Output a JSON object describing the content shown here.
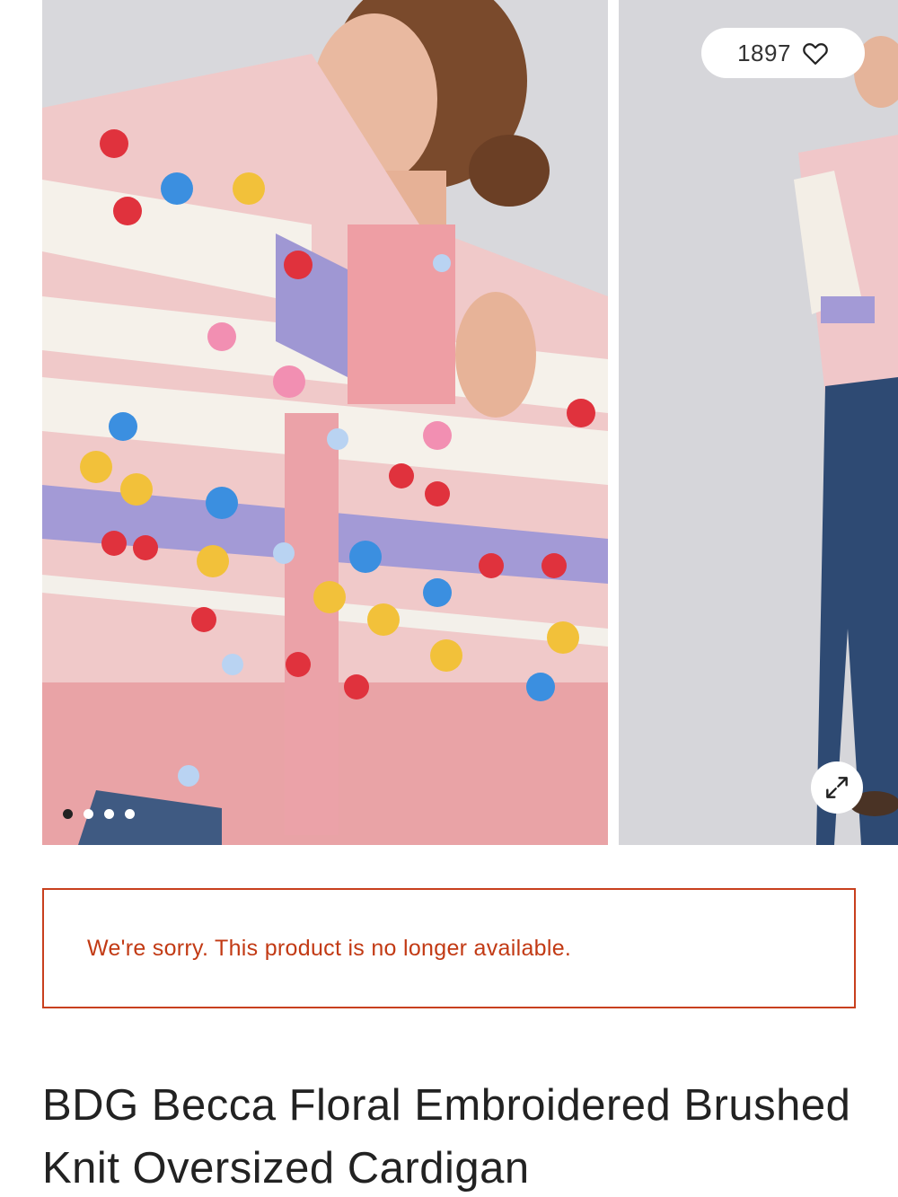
{
  "gallery": {
    "favorites_count": "1897",
    "icons": {
      "favorite": "heart-outline-icon",
      "expand": "expand-arrows-icon"
    },
    "dots": {
      "total": 4,
      "active_index": 0
    }
  },
  "notice": {
    "message": "We're sorry. This product is no longer available.",
    "color": "#c23a14"
  },
  "product": {
    "title": "BDG Becca Floral Embroidered Brushed Knit Oversized Cardigan"
  }
}
